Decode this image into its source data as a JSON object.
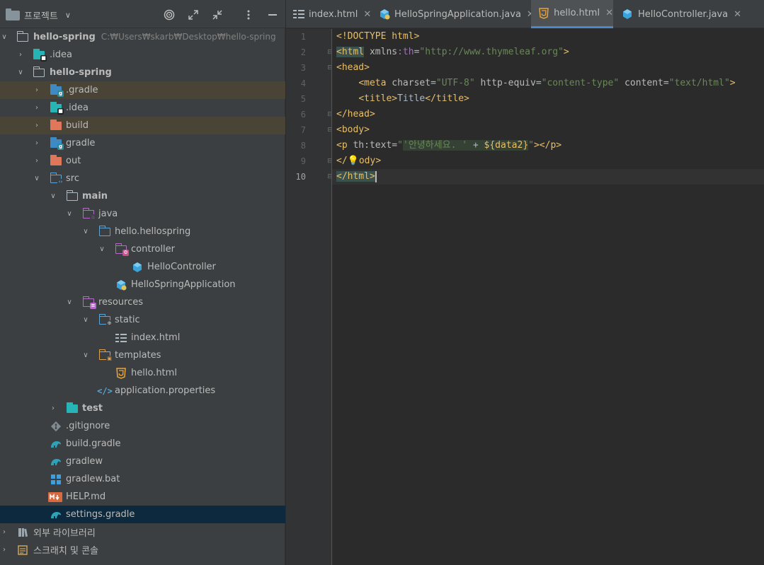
{
  "project_panel": {
    "title": "프로젝트",
    "toolbar": [
      "target-icon",
      "expand-icon",
      "collapse-icon",
      "more-icon",
      "minimize-icon"
    ]
  },
  "tree": [
    {
      "label": "hello-spring",
      "path": "C:₩Users₩skarb₩Desktop₩hello-spring",
      "bold": true
    },
    {
      "label": ".idea"
    },
    {
      "label": "hello-spring",
      "bold": true
    },
    {
      "label": ".gradle"
    },
    {
      "label": ".idea"
    },
    {
      "label": "build"
    },
    {
      "label": "gradle"
    },
    {
      "label": "out"
    },
    {
      "label": "src"
    },
    {
      "label": "main",
      "bold": true
    },
    {
      "label": "java"
    },
    {
      "label": "hello.hellospring"
    },
    {
      "label": "controller"
    },
    {
      "label": "HelloController"
    },
    {
      "label": "HelloSpringApplication"
    },
    {
      "label": "resources"
    },
    {
      "label": "static"
    },
    {
      "label": "index.html"
    },
    {
      "label": "templates"
    },
    {
      "label": "hello.html"
    },
    {
      "label": "application.properties"
    },
    {
      "label": "test",
      "bold": true
    },
    {
      "label": ".gitignore"
    },
    {
      "label": "build.gradle"
    },
    {
      "label": "gradlew"
    },
    {
      "label": "gradlew.bat"
    },
    {
      "label": "HELP.md"
    },
    {
      "label": "settings.gradle"
    },
    {
      "label": "외부 라이브러리"
    },
    {
      "label": "스크래치 및 콘솔"
    }
  ],
  "tabs": [
    {
      "label": "index.html",
      "icon": "html-file-icon",
      "active": false
    },
    {
      "label": "HelloSpringApplication.java",
      "icon": "spring-boot-class-icon",
      "active": false
    },
    {
      "label": "hello.html",
      "icon": "html5-icon",
      "active": true
    },
    {
      "label": "HelloController.java",
      "icon": "java-class-icon",
      "active": false
    }
  ],
  "editor": {
    "line_numbers": [
      "1",
      "2",
      "3",
      "4",
      "5",
      "6",
      "7",
      "8",
      "9",
      "10"
    ],
    "current_line": 10,
    "code": {
      "l1": "<!DOCTYPE html>",
      "l2_tag": "html",
      "l2_ns": "xmlns",
      "l2_attr": ":th",
      "l2_val": "\"http://www.thymeleaf.org\"",
      "l3": "head",
      "l4_tag": "meta",
      "l4_a1": "charset",
      "l4_v1": "\"UTF-8\"",
      "l4_a2": "http-equiv",
      "l4_v2": "\"content-type\"",
      "l4_a3": "content",
      "l4_v3": "\"text/html\"",
      "l5_tag": "title",
      "l5_text": "Title",
      "l6": "head",
      "l7": "body",
      "l8_tag": "p",
      "l8_attr": "th:text",
      "l8_str": "'안녕하세요. '",
      "l8_plus": " + ",
      "l8_expr": "${data2}",
      "l9": "ody",
      "l10": "html"
    }
  }
}
